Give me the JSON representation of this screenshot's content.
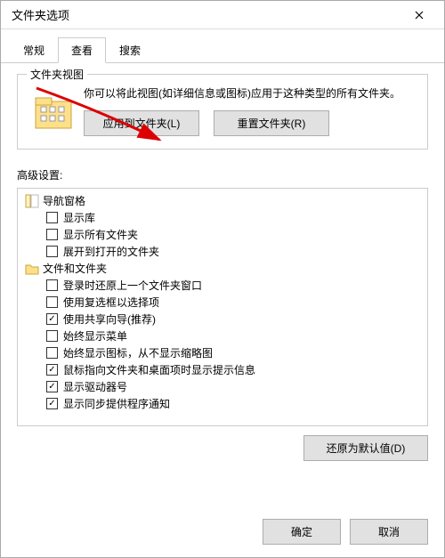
{
  "window": {
    "title": "文件夹选项"
  },
  "tabs": {
    "general": "常规",
    "view": "查看",
    "search": "搜索",
    "active": "view"
  },
  "folderView": {
    "groupTitle": "文件夹视图",
    "description": "你可以将此视图(如详细信息或图标)应用于这种类型的所有文件夹。",
    "applyBtn": "应用到文件夹(L)",
    "resetBtn": "重置文件夹(R)"
  },
  "advanced": {
    "label": "高级设置:",
    "restoreBtn": "还原为默认值(D)",
    "items": [
      {
        "type": "group",
        "icon": "nav",
        "label": "导航窗格"
      },
      {
        "type": "check",
        "checked": false,
        "label": "显示库"
      },
      {
        "type": "check",
        "checked": false,
        "label": "显示所有文件夹"
      },
      {
        "type": "check",
        "checked": false,
        "label": "展开到打开的文件夹"
      },
      {
        "type": "group",
        "icon": "folder",
        "label": "文件和文件夹"
      },
      {
        "type": "check",
        "checked": false,
        "label": "登录时还原上一个文件夹窗口"
      },
      {
        "type": "check",
        "checked": false,
        "label": "使用复选框以选择项"
      },
      {
        "type": "check",
        "checked": true,
        "label": "使用共享向导(推荐)"
      },
      {
        "type": "check",
        "checked": false,
        "label": "始终显示菜单"
      },
      {
        "type": "check",
        "checked": false,
        "label": "始终显示图标，从不显示缩略图"
      },
      {
        "type": "check",
        "checked": true,
        "label": "鼠标指向文件夹和桌面项时显示提示信息"
      },
      {
        "type": "check",
        "checked": true,
        "label": "显示驱动器号"
      },
      {
        "type": "check",
        "checked": true,
        "label": "显示同步提供程序通知"
      }
    ]
  },
  "buttons": {
    "ok": "确定",
    "cancel": "取消"
  }
}
